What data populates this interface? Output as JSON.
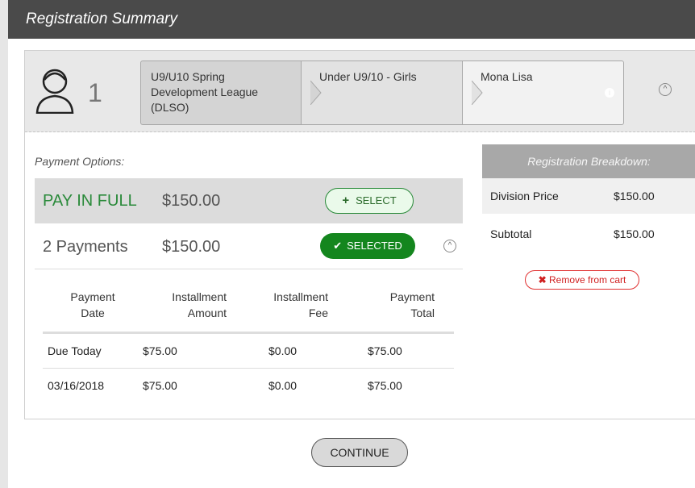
{
  "header": {
    "title": "Registration Summary"
  },
  "registrant": {
    "count": "1",
    "breadcrumb": [
      "U9/U10 Spring Development League (DLSO)",
      "Under U9/10 - Girls",
      "Mona Lisa"
    ]
  },
  "payment": {
    "label": "Payment Options:",
    "options": [
      {
        "name": "PAY IN FULL",
        "amount": "$150.00",
        "button": "SELECT"
      },
      {
        "name": "2 Payments",
        "amount": "$150.00",
        "button": "SELECTED"
      }
    ],
    "schedule": {
      "headers": [
        [
          "Payment",
          "Date"
        ],
        [
          "Installment",
          "Amount"
        ],
        [
          "Installment",
          "Fee"
        ],
        [
          "Payment",
          "Total"
        ]
      ],
      "rows": [
        [
          "Due Today",
          "$75.00",
          "$0.00",
          "$75.00"
        ],
        [
          "03/16/2018",
          "$75.00",
          "$0.00",
          "$75.00"
        ]
      ]
    }
  },
  "breakdown": {
    "title": "Registration Breakdown:",
    "rows": [
      {
        "label": "Division Price",
        "value": "$150.00"
      },
      {
        "label": "Subtotal",
        "value": "$150.00"
      }
    ],
    "remove_label": "Remove from cart"
  },
  "continue_label": "CONTINUE",
  "colors": {
    "accent_green": "#14861e",
    "title_bar": "#4a4a4a",
    "remove_red": "#e03030"
  }
}
